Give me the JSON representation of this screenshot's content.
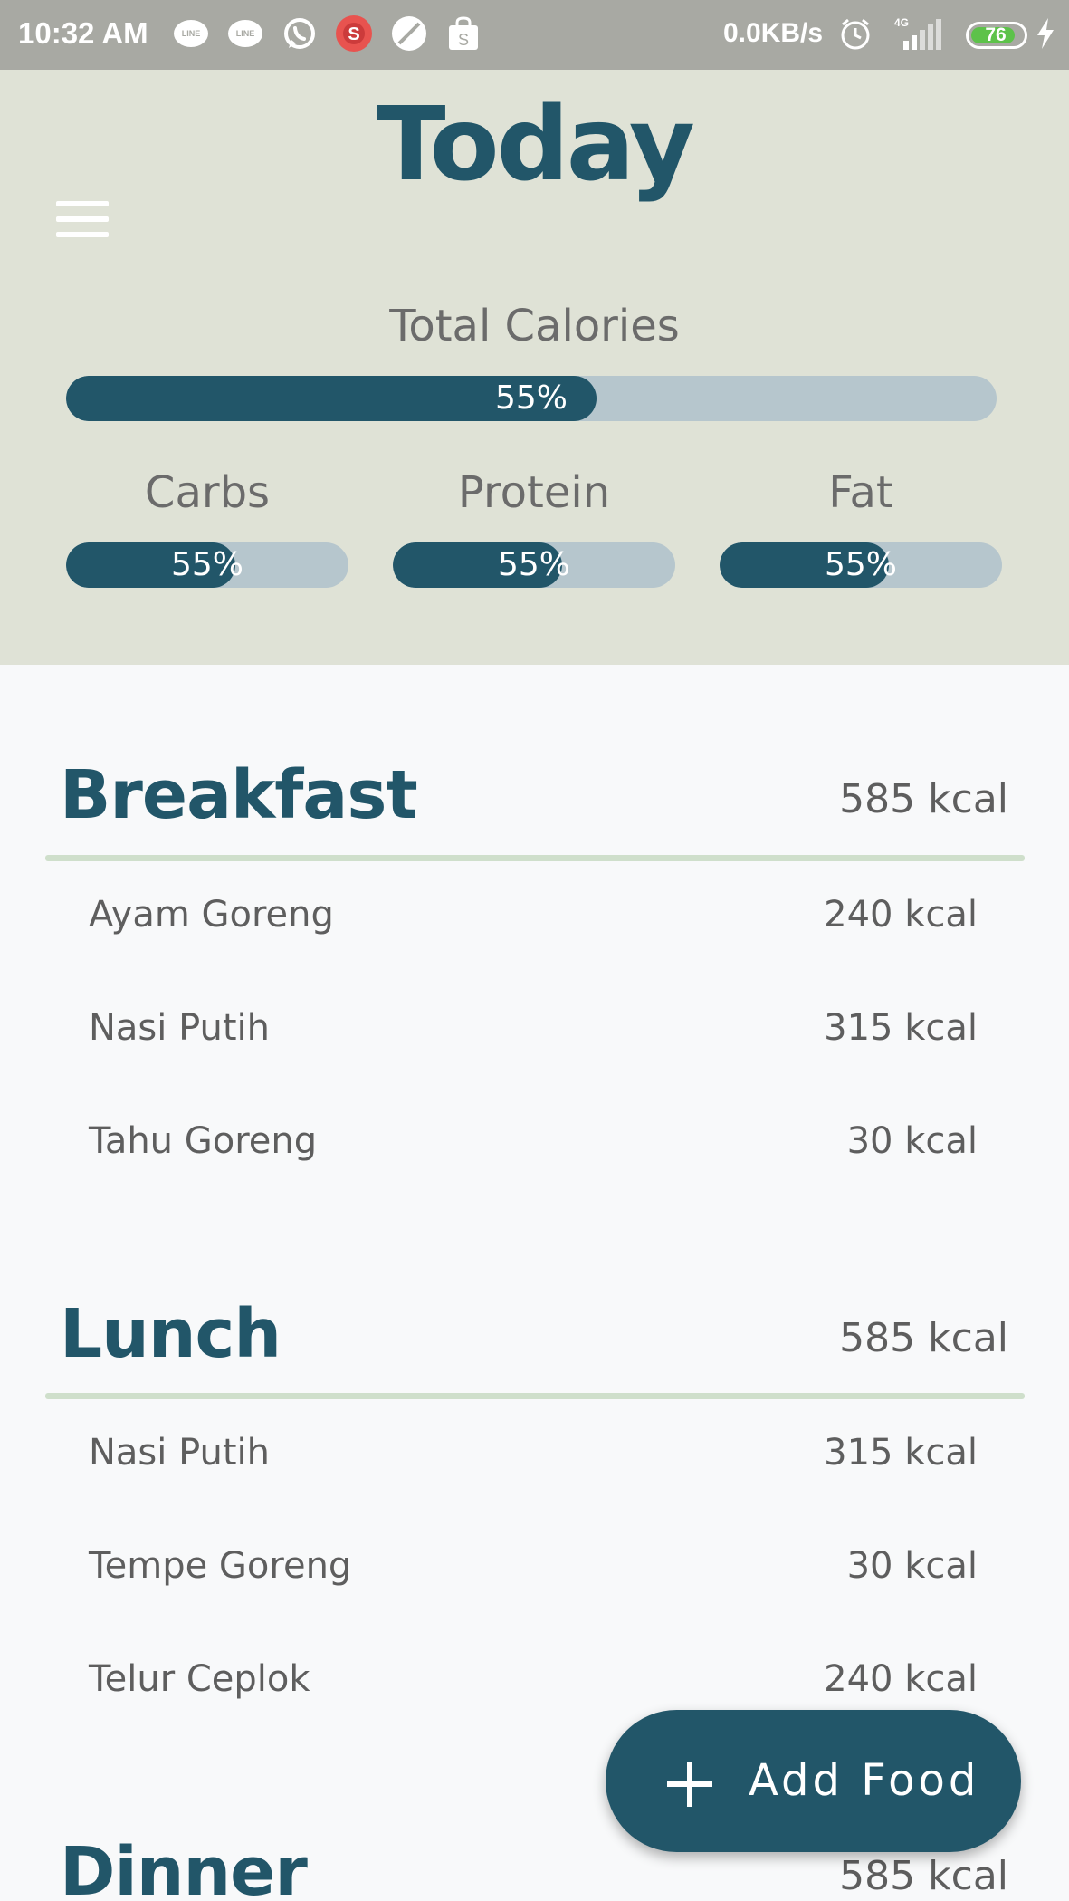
{
  "status_bar": {
    "time": "10:32 AM",
    "net_speed": "0.0KB/s",
    "network": "4G",
    "battery": "76",
    "icons": [
      "line-icon",
      "line-icon",
      "whatsapp-icon",
      "s-app-icon",
      "browser-icon",
      "shopping-bag-icon",
      "alarm-icon",
      "signal-icon",
      "charging-icon"
    ]
  },
  "header": {
    "title": "Today",
    "total_label": "Total Calories",
    "total_progress": 0.57,
    "total_text": "55%",
    "macros": [
      {
        "label": "Carbs",
        "progress": 0.6,
        "text": "55%"
      },
      {
        "label": "Protein",
        "progress": 0.6,
        "text": "55%"
      },
      {
        "label": "Fat",
        "progress": 0.6,
        "text": "55%"
      }
    ],
    "colors": {
      "background": "#dfe2d6",
      "accent": "#225669",
      "track": "#b6c6cd"
    }
  },
  "meals": [
    {
      "name": "Breakfast",
      "kcal": "585 kcal",
      "items": [
        {
          "name": "Ayam Goreng",
          "kcal": "240 kcal"
        },
        {
          "name": "Nasi Putih",
          "kcal": "315 kcal"
        },
        {
          "name": "Tahu Goreng",
          "kcal": "30 kcal"
        }
      ]
    },
    {
      "name": "Lunch",
      "kcal": "585 kcal",
      "items": [
        {
          "name": "Nasi Putih",
          "kcal": "315 kcal"
        },
        {
          "name": "Tempe Goreng",
          "kcal": "30 kcal"
        },
        {
          "name": "Telur Ceplok",
          "kcal": "240 kcal"
        }
      ]
    },
    {
      "name": "Dinner",
      "kcal": "585 kcal",
      "items": []
    }
  ],
  "fab": {
    "label": "Add Food"
  }
}
